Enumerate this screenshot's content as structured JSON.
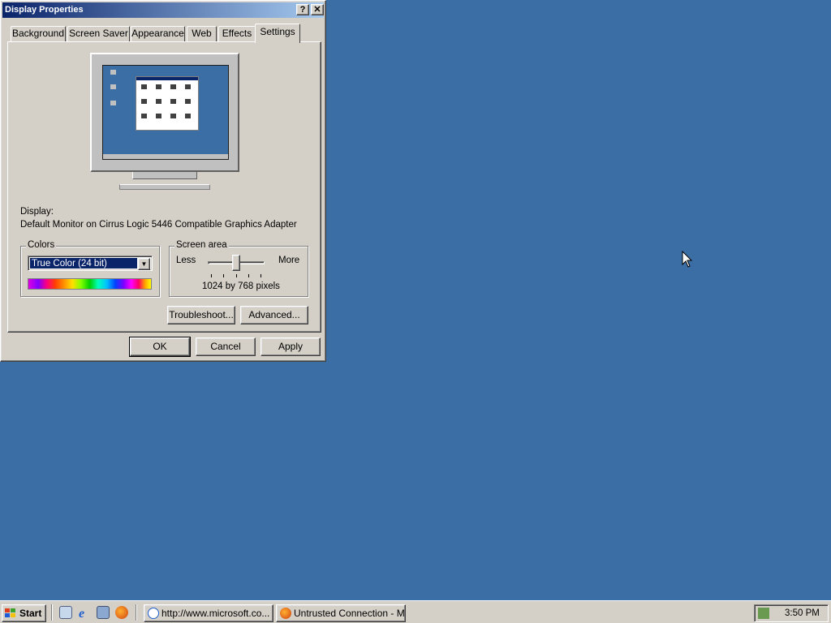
{
  "dialog": {
    "title": "Display Properties",
    "help_button": "?",
    "close_button": "✕",
    "tabs": [
      {
        "label": "Background"
      },
      {
        "label": "Screen Saver"
      },
      {
        "label": "Appearance"
      },
      {
        "label": "Web"
      },
      {
        "label": "Effects"
      },
      {
        "label": "Settings",
        "active": true
      }
    ],
    "display_label": "Display:",
    "display_value": "Default Monitor on Cirrus Logic 5446 Compatible Graphics Adapter",
    "colors": {
      "group_title": "Colors",
      "selected": "True Color (24 bit)"
    },
    "screen_area": {
      "group_title": "Screen area",
      "less": "Less",
      "more": "More",
      "value_text": "1024 by 768 pixels"
    },
    "buttons": {
      "troubleshoot": "Troubleshoot...",
      "advanced": "Advanced...",
      "ok": "OK",
      "cancel": "Cancel",
      "apply": "Apply"
    }
  },
  "taskbar": {
    "start": "Start",
    "tasks": [
      {
        "label": "http://www.microsoft.co..."
      },
      {
        "label": "Untrusted Connection - M..."
      }
    ],
    "clock": "3:50 PM"
  },
  "colors": {
    "desktop": "#3a6ea5",
    "titlebar_start": "#0a246a",
    "titlebar_end": "#a6caf0",
    "face": "#d4d0c8"
  }
}
